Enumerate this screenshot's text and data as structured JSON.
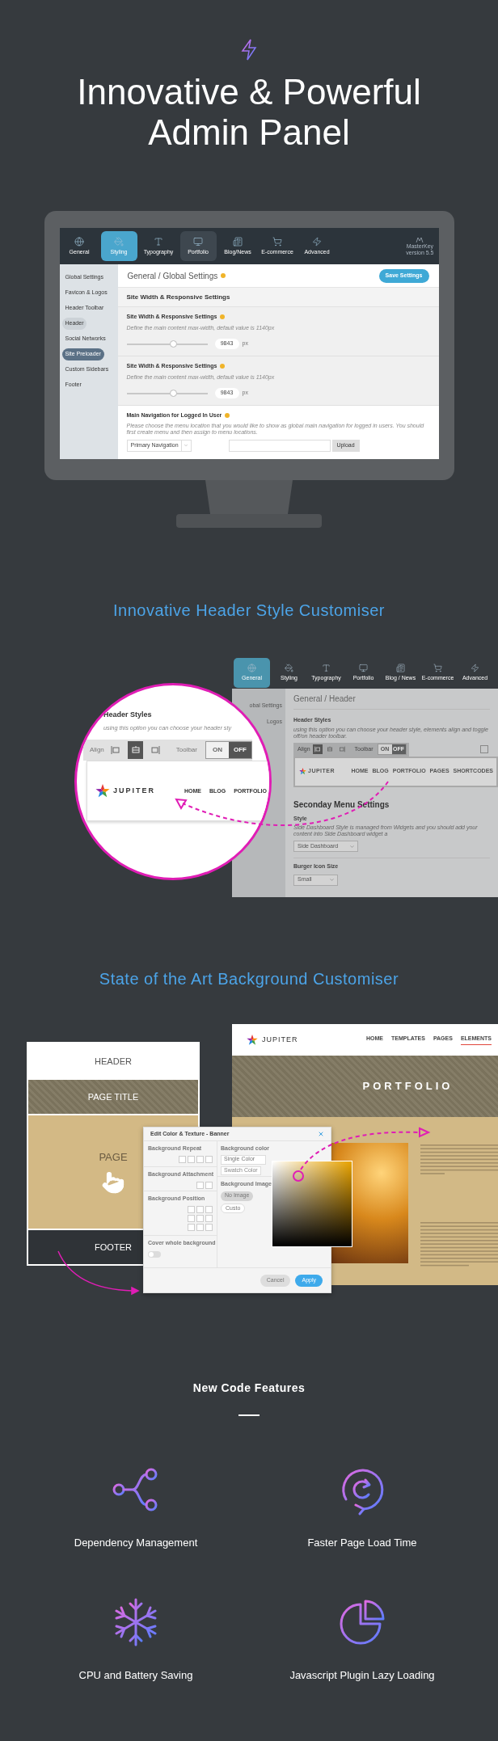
{
  "hero": {
    "title_lines": [
      "Innovative & Powerful",
      "Admin Panel"
    ]
  },
  "admin_panel": {
    "tabs": [
      {
        "label": "General",
        "selected": false,
        "highlighted": false
      },
      {
        "label": "Styling",
        "selected": true,
        "highlighted": false
      },
      {
        "label": "Typography",
        "selected": false,
        "highlighted": false
      },
      {
        "label": "Portfolio",
        "selected": false,
        "highlighted": true
      },
      {
        "label": "Blog/News",
        "selected": false,
        "highlighted": false
      },
      {
        "label": "E-commerce",
        "selected": false,
        "highlighted": false
      },
      {
        "label": "Advanced",
        "selected": false,
        "highlighted": false
      }
    ],
    "brand": {
      "name": "MasterKey",
      "version": "version 5.5"
    },
    "sidebar": [
      {
        "label": "Global Settings",
        "selected": false,
        "highlighted": false
      },
      {
        "label": "Favicon & Logos",
        "selected": false,
        "highlighted": false
      },
      {
        "label": "Header Toolbar",
        "selected": false,
        "highlighted": false
      },
      {
        "label": "Header",
        "selected": false,
        "highlighted": true
      },
      {
        "label": "Social Networks",
        "selected": false,
        "highlighted": false
      },
      {
        "label": "Site Preloader",
        "selected": true,
        "highlighted": false
      },
      {
        "label": "Custom Sidebars",
        "selected": false,
        "highlighted": false
      },
      {
        "label": "Footer",
        "selected": false,
        "highlighted": false
      }
    ],
    "page_title": "General / Global Settings",
    "save_button": "Save Settings",
    "section_title": "Site Width & Responsive Settings",
    "settings": [
      {
        "label": "Site Width & Responsive Settings",
        "description": "Define the main content max-width, default value is 1140px",
        "level": 0.58,
        "value": "9843",
        "unit": "px"
      },
      {
        "label": "Site Width & Responsive Settings",
        "description": "Define the main content max-width, default value is 1140px",
        "level": 0.58,
        "value": "9843",
        "unit": "px"
      }
    ],
    "navigation_setting": {
      "label": "Main Navigation for Logged In User",
      "description": "Please choose the menu location that you would like to show as global main navigation for logged in users. You should first create menu and then assign to menu locations.",
      "select": "Primary Navigation",
      "upload_button": "Upload"
    }
  },
  "header_customiser": {
    "heading": "Innovative Header Style Customiser",
    "panel": {
      "tabs": [
        {
          "label": "General",
          "selected": true
        },
        {
          "label": "Styling",
          "selected": false
        },
        {
          "label": "Typography",
          "selected": false
        },
        {
          "label": "Portfolio",
          "selected": false
        },
        {
          "label": "Blog / News",
          "selected": false
        },
        {
          "label": "E-commerce",
          "selected": false
        },
        {
          "label": "Advanced",
          "selected": false
        }
      ],
      "sidebar": [
        "obal Settings",
        "Logos"
      ],
      "page_title": "General / Header",
      "header_styles": {
        "label": "Header Styles",
        "description": "using this option you can choose your header style, elements align and toggle off/on header toolbar.",
        "align_label": "Align",
        "align_options": [
          {
            "selected": true
          },
          {
            "selected": false
          },
          {
            "selected": false
          }
        ],
        "toolbar_label": "Toolbar",
        "toolbar_on": false,
        "on_label": "ON",
        "off_label": "OFF",
        "logo": "JUPITER",
        "menu": [
          "HOME",
          "BLOG",
          "PORTFOLIO",
          "PAGES",
          "SHORTCODES"
        ]
      },
      "secondary_menu": {
        "title": "Seconday Menu Settings",
        "style_label": "Style",
        "description": "Side Dashboard Style is managed from Widgets and you should add your content into Side Dashboard widget a",
        "select": "Side Dashboard"
      },
      "burger_icon": {
        "label": "Burger Icon Size",
        "select": "Small"
      }
    },
    "magnifier": {
      "label": "Header Styles",
      "description": "using this option you can choose your header sty",
      "align_label": "Align",
      "align_options": [
        {
          "selected": false
        },
        {
          "selected": true
        },
        {
          "selected": false
        }
      ],
      "toolbar_label": "Toolbar",
      "toolbar_on": false,
      "on_label": "ON",
      "off_label": "OFF",
      "logo": "JUPITER",
      "menu": [
        "HOME",
        "BLOG",
        "PORTFOLIO"
      ]
    }
  },
  "background_customiser": {
    "heading": "State of the Art Background Customiser",
    "layout_diagram": {
      "header": "HEADER",
      "page_title": "PAGE TITLE",
      "page": "PAGE",
      "footer": "FOOTER"
    },
    "dialog": {
      "title": "Edit Color & Texture - Banner",
      "repeat_label": "Background Repeat",
      "attachment_label": "Background Attachment",
      "position_label": "Background Position",
      "cover_label": "Cover whole background",
      "cover_on": false,
      "color_label": "Background color",
      "color_select": "Single Color",
      "swatch_button": "Swatch Color",
      "image_label": "Background Image",
      "image_options": [
        {
          "label": "No Image",
          "selected": true
        },
        {
          "label": "Custo",
          "selected": false
        }
      ],
      "cancel_button": "Cancel",
      "apply_button": "Apply"
    },
    "site_preview": {
      "logo": "JUPITER",
      "menu": [
        {
          "label": "HOME",
          "selected": false
        },
        {
          "label": "TEMPLATES",
          "selected": false
        },
        {
          "label": "PAGES",
          "selected": false
        },
        {
          "label": "ELEMENTS",
          "selected": true
        }
      ],
      "banner_title": "PORTFOLIO"
    }
  },
  "features": {
    "heading": "New Code Features",
    "items": [
      {
        "label": "Dependency Management"
      },
      {
        "label": "Faster Page Load Time"
      },
      {
        "label": "CPU and Battery Saving"
      },
      {
        "label": "Javascript Plugin Lazy Loading"
      }
    ]
  }
}
